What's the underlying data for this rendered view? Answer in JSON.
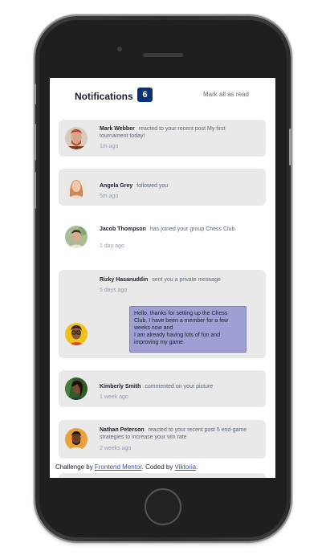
{
  "header": {
    "title": "Notifications",
    "unread_count": "6",
    "mark_all_label": "Mark all as read"
  },
  "notifications": [
    {
      "name": "Mark Webber",
      "action": "reacted to your recent post",
      "target": "My first tournament today!",
      "time": "1m ago",
      "unread": true,
      "avatar": "avatar-mark-webber"
    },
    {
      "name": "Angela Grey",
      "action": "followed you",
      "time": "5m ago",
      "unread": true,
      "avatar": "avatar-angela-grey"
    },
    {
      "name": "Jacob Thompson",
      "action": "has joined your group",
      "target": "Chess Club",
      "time": "1 day ago",
      "unread": false,
      "avatar": "avatar-jacob-thompson"
    },
    {
      "name": "Rizky Hasanuddin",
      "action": "sent you a private message",
      "time": "5 days ago",
      "message": "Hello, thanks for setting up the Chess Club. I have been a member for a few weeks now and\nI am already having lots of fun and improving my game.",
      "unread": true,
      "avatar": "avatar-rizky-hasanuddin"
    },
    {
      "name": "Kimberly Smith",
      "action": "commented on your picture",
      "time": "1 week ago",
      "unread": true,
      "avatar": "avatar-kimberly-smith"
    },
    {
      "name": "Nathan Peterson",
      "action": "reacted to your recent post",
      "target": "5 end-game strategies to increase your win rate",
      "time": "2 weeks ago",
      "unread": true,
      "avatar": "avatar-nathan-peterson"
    }
  ],
  "footer": {
    "prefix": "Challenge by ",
    "link1": "Frontend Mentor",
    "middle": ". Coded by ",
    "link2": "Viktoria",
    "suffix": "."
  },
  "colors": {
    "badge": "#0a327b",
    "card_unread": "#e9e9e9",
    "message_bg": "#9f9fd4",
    "link": "#3e52a3",
    "phone_body": "#2e2e2e"
  }
}
